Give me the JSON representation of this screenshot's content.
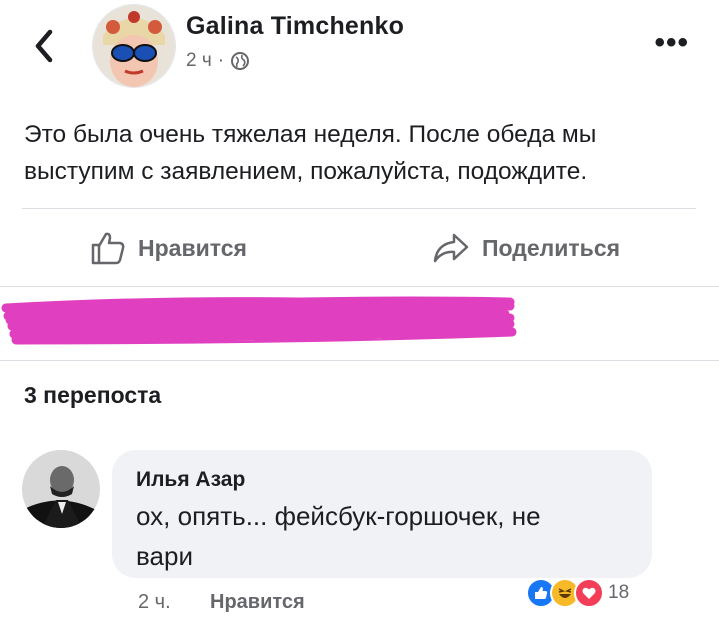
{
  "header": {
    "author": "Galina Timchenko",
    "time": "2 ч",
    "dot": "·",
    "audience_icon": "globe-icon",
    "back_icon": "chevron-left-icon",
    "more_label": "•••"
  },
  "post": {
    "text_line1": "Это была очень тяжелая неделя. После обеда мы",
    "text_line2": "выступим с заявлением, пожалуйста, подождите."
  },
  "actions": {
    "like_label": "Нравится",
    "share_label": "Поделиться"
  },
  "colors": {
    "redaction": "#e040c0",
    "like_blue": "#1877f2",
    "love_red": "#f33e58",
    "haha_yellow": "#f7b928"
  },
  "reposts": {
    "label": "3 перепоста"
  },
  "comment": {
    "author": "Илья Азар",
    "text_line1": "ох, опять... фейсбук-горшочек, не",
    "text_line2": "вари",
    "time": "2 ч.",
    "like_label": "Нравится",
    "reaction_icons": [
      "like-reaction-icon",
      "haha-reaction-icon",
      "love-reaction-icon"
    ],
    "reaction_count": "18"
  }
}
